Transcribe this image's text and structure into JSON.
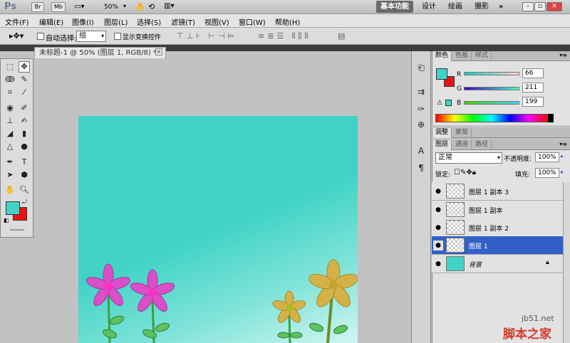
{
  "appbar": {
    "logo": "Ps",
    "br": "Br",
    "mb": "Mb",
    "zoom": "50%",
    "workspaces": [
      "基本功能",
      "设计",
      "绘画",
      "摄影"
    ],
    "more": "»"
  },
  "menu": [
    "文件(F)",
    "编辑(E)",
    "图像(I)",
    "图层(L)",
    "选择(S)",
    "滤镜(T)",
    "视图(V)",
    "窗口(W)",
    "帮助(H)"
  ],
  "options": {
    "auto_select": "自动选择:",
    "auto_select_value": "组",
    "show_transform": "显示变换控件"
  },
  "document": {
    "tab_title": "未标题-1 @ 50% (图层 1, RGB/8) *",
    "tab_close": "×"
  },
  "color_panel": {
    "tabs": [
      "颜色",
      "色板",
      "样式"
    ],
    "channels": [
      {
        "label": "R",
        "value": "66"
      },
      {
        "label": "G",
        "value": "211"
      },
      {
        "label": "B",
        "value": "199"
      }
    ],
    "foreground": "#42d3c7",
    "background": "#ee1111"
  },
  "adjust_tabs": [
    "调整",
    "蒙版"
  ],
  "layers_panel": {
    "tabs": [
      "图层",
      "通道",
      "路径"
    ],
    "blend_mode": "正常",
    "opacity_label": "不透明度:",
    "opacity": "100%",
    "lock_label": "锁定:",
    "fill_label": "填充:",
    "fill": "100%",
    "layers": [
      {
        "name": "图层 1 副本 3",
        "selected": false
      },
      {
        "name": "图层 1 副本",
        "selected": false
      },
      {
        "name": "图层 1 副本 2",
        "selected": false
      },
      {
        "name": "图层 1",
        "selected": true
      },
      {
        "name": "背景",
        "selected": false
      }
    ]
  },
  "watermark": {
    "site": "jb51.net",
    "brand": "脚本之家"
  }
}
